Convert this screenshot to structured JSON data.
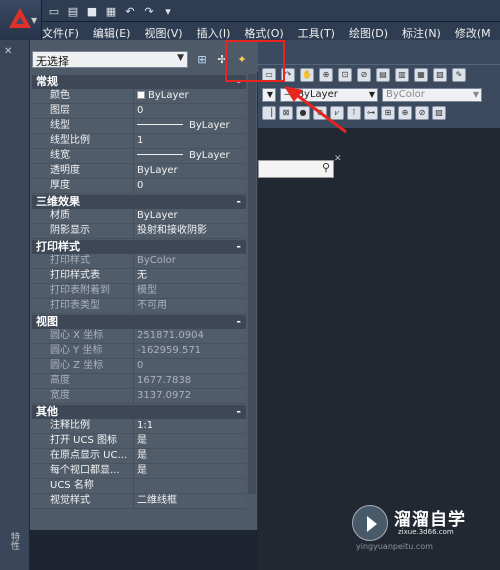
{
  "menubar": [
    "文件(F)",
    "编辑(E)",
    "视图(V)",
    "插入(I)",
    "格式(O)",
    "工具(T)",
    "绘图(D)",
    "标注(N)",
    "修改(M"
  ],
  "qat_icons": [
    "new-icon",
    "open-icon",
    "save-icon",
    "print-icon",
    "undo-icon",
    "redo-icon",
    "dropdown-icon"
  ],
  "toolbar": {
    "layer_value": "ByLayer",
    "color_value": "ByColor"
  },
  "panel": {
    "selection": "无选择",
    "sections": [
      {
        "title": "常规",
        "collapse": "-",
        "rows": [
          {
            "k": "颜色",
            "v": "ByLayer",
            "swatch": true
          },
          {
            "k": "图层",
            "v": "0"
          },
          {
            "k": "线型",
            "v": "ByLayer",
            "line": true
          },
          {
            "k": "线型比例",
            "v": "1"
          },
          {
            "k": "线宽",
            "v": "ByLayer",
            "line": true
          },
          {
            "k": "透明度",
            "v": "ByLayer"
          },
          {
            "k": "厚度",
            "v": "0"
          }
        ]
      },
      {
        "title": "三维效果",
        "collapse": "-",
        "rows": [
          {
            "k": "材质",
            "v": "ByLayer"
          },
          {
            "k": "阴影显示",
            "v": "投射和接收阴影"
          }
        ]
      },
      {
        "title": "打印样式",
        "collapse": "-",
        "rows": [
          {
            "k": "打印样式",
            "v": "ByColor",
            "dim": true
          },
          {
            "k": "打印样式表",
            "v": "无"
          },
          {
            "k": "打印表附着到",
            "v": "模型",
            "dim": true
          },
          {
            "k": "打印表类型",
            "v": "不可用",
            "dim": true
          }
        ]
      },
      {
        "title": "视图",
        "collapse": "-",
        "rows": [
          {
            "k": "圆心 X 坐标",
            "v": "251871.0904",
            "dim": true
          },
          {
            "k": "圆心 Y 坐标",
            "v": "-162959.571",
            "dim": true
          },
          {
            "k": "圆心 Z 坐标",
            "v": "0",
            "dim": true
          },
          {
            "k": "高度",
            "v": "1677.7838",
            "dim": true
          },
          {
            "k": "宽度",
            "v": "3137.0972",
            "dim": true
          }
        ]
      },
      {
        "title": "其他",
        "collapse": "-",
        "rows": [
          {
            "k": "注释比例",
            "v": "1:1"
          },
          {
            "k": "打开 UCS 图标",
            "v": "是"
          },
          {
            "k": "在原点显示 UC...",
            "v": "是"
          },
          {
            "k": "每个视口都显...",
            "v": "是"
          },
          {
            "k": "UCS 名称",
            "v": ""
          },
          {
            "k": "视觉样式",
            "v": "二维线框"
          }
        ]
      }
    ]
  },
  "side_label": "特性",
  "watermark": {
    "title": "溜溜自学",
    "url": "zixue.3d66.com",
    "sub": "yingyuanpeitu.com"
  }
}
